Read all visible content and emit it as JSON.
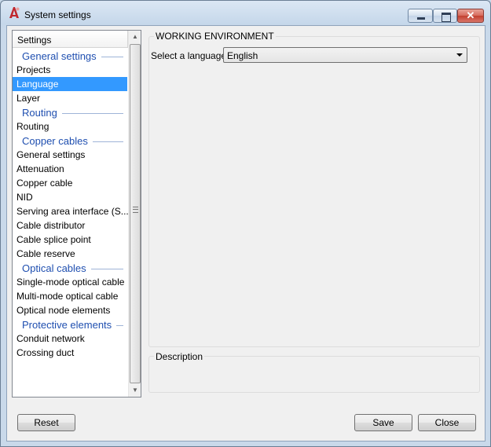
{
  "window": {
    "title": "System settings",
    "app_icon": "autocad-a-icon"
  },
  "titlebar_buttons": [
    "minimize",
    "maximize",
    "close"
  ],
  "nav": {
    "header": "Settings",
    "sections": [
      {
        "group": "General settings",
        "items": [
          "Projects",
          "Language",
          "Layer"
        ]
      },
      {
        "group": "Routing",
        "items": [
          "Routing"
        ]
      },
      {
        "group": "Copper cables",
        "items": [
          "General settings",
          "Attenuation",
          "Copper cable",
          "NID",
          "Serving area interface (S...",
          "Cable distributor",
          "Cable splice point",
          "Cable reserve"
        ]
      },
      {
        "group": "Optical cables",
        "items": [
          "Single-mode optical cable",
          "Multi-mode optical cable",
          "Optical node elements"
        ]
      },
      {
        "group": "Protective elements",
        "items": [
          "Conduit network",
          "Crossing duct"
        ]
      }
    ],
    "selected_item": "Language"
  },
  "panel": {
    "group_title": "WORKING ENVIRONMENT",
    "language_label": "Select a language",
    "language_value": "English",
    "description_title": "Description"
  },
  "buttons": {
    "reset": "Reset",
    "save": "Save",
    "close": "Close"
  },
  "colors": {
    "selection": "#3399ff",
    "group_header": "#1f4fb0",
    "close_button": "#c2402f"
  }
}
